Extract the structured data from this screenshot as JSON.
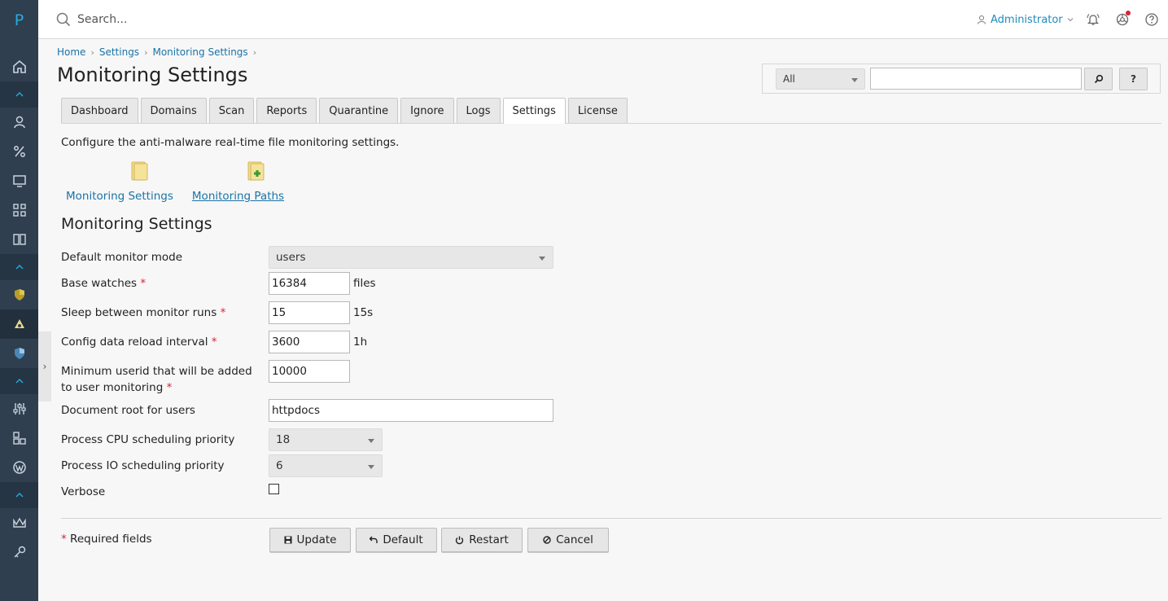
{
  "header": {
    "logo": "P",
    "search_placeholder": "Search...",
    "user_label": "Administrator"
  },
  "breadcrumb": [
    "Home",
    "Settings",
    "Monitoring Settings"
  ],
  "page_title": "Monitoring Settings",
  "filter": {
    "select_value": "All",
    "search_button_icon": "magnifier-icon",
    "help_label": "?"
  },
  "tabs": [
    "Dashboard",
    "Domains",
    "Scan",
    "Reports",
    "Quarantine",
    "Ignore",
    "Logs",
    "Settings",
    "License"
  ],
  "active_tab": "Settings",
  "intro": "Configure the anti-malware real-time file monitoring settings.",
  "nav_links": [
    {
      "label": "Monitoring Settings",
      "icon": "folder-icon"
    },
    {
      "label": "Monitoring Paths",
      "icon": "folder-add-icon"
    }
  ],
  "section_title": "Monitoring Settings",
  "form": {
    "default_monitor_mode": {
      "label": "Default monitor mode",
      "value": "users"
    },
    "base_watches": {
      "label": "Base watches",
      "value": "16384",
      "unit": "files"
    },
    "sleep_between": {
      "label": "Sleep between monitor runs",
      "value": "15",
      "unit": "15s"
    },
    "config_reload": {
      "label": "Config data reload interval",
      "value": "3600",
      "unit": "1h"
    },
    "min_userid": {
      "label": "Minimum userid that will be added to user monitoring",
      "value": "10000"
    },
    "doc_root": {
      "label": "Document root for users",
      "value": "httpdocs"
    },
    "cpu_priority": {
      "label": "Process CPU scheduling priority",
      "value": "18"
    },
    "io_priority": {
      "label": "Process IO scheduling priority",
      "value": "6"
    },
    "verbose": {
      "label": "Verbose",
      "checked": false
    }
  },
  "required_note": "Required fields",
  "required_mark": "*",
  "buttons": {
    "update": "Update",
    "default": "Default",
    "restart": "Restart",
    "cancel": "Cancel"
  },
  "colors": {
    "sidebar": "#2f3f4f",
    "link": "#1a73a8",
    "required": "#d6233a"
  }
}
